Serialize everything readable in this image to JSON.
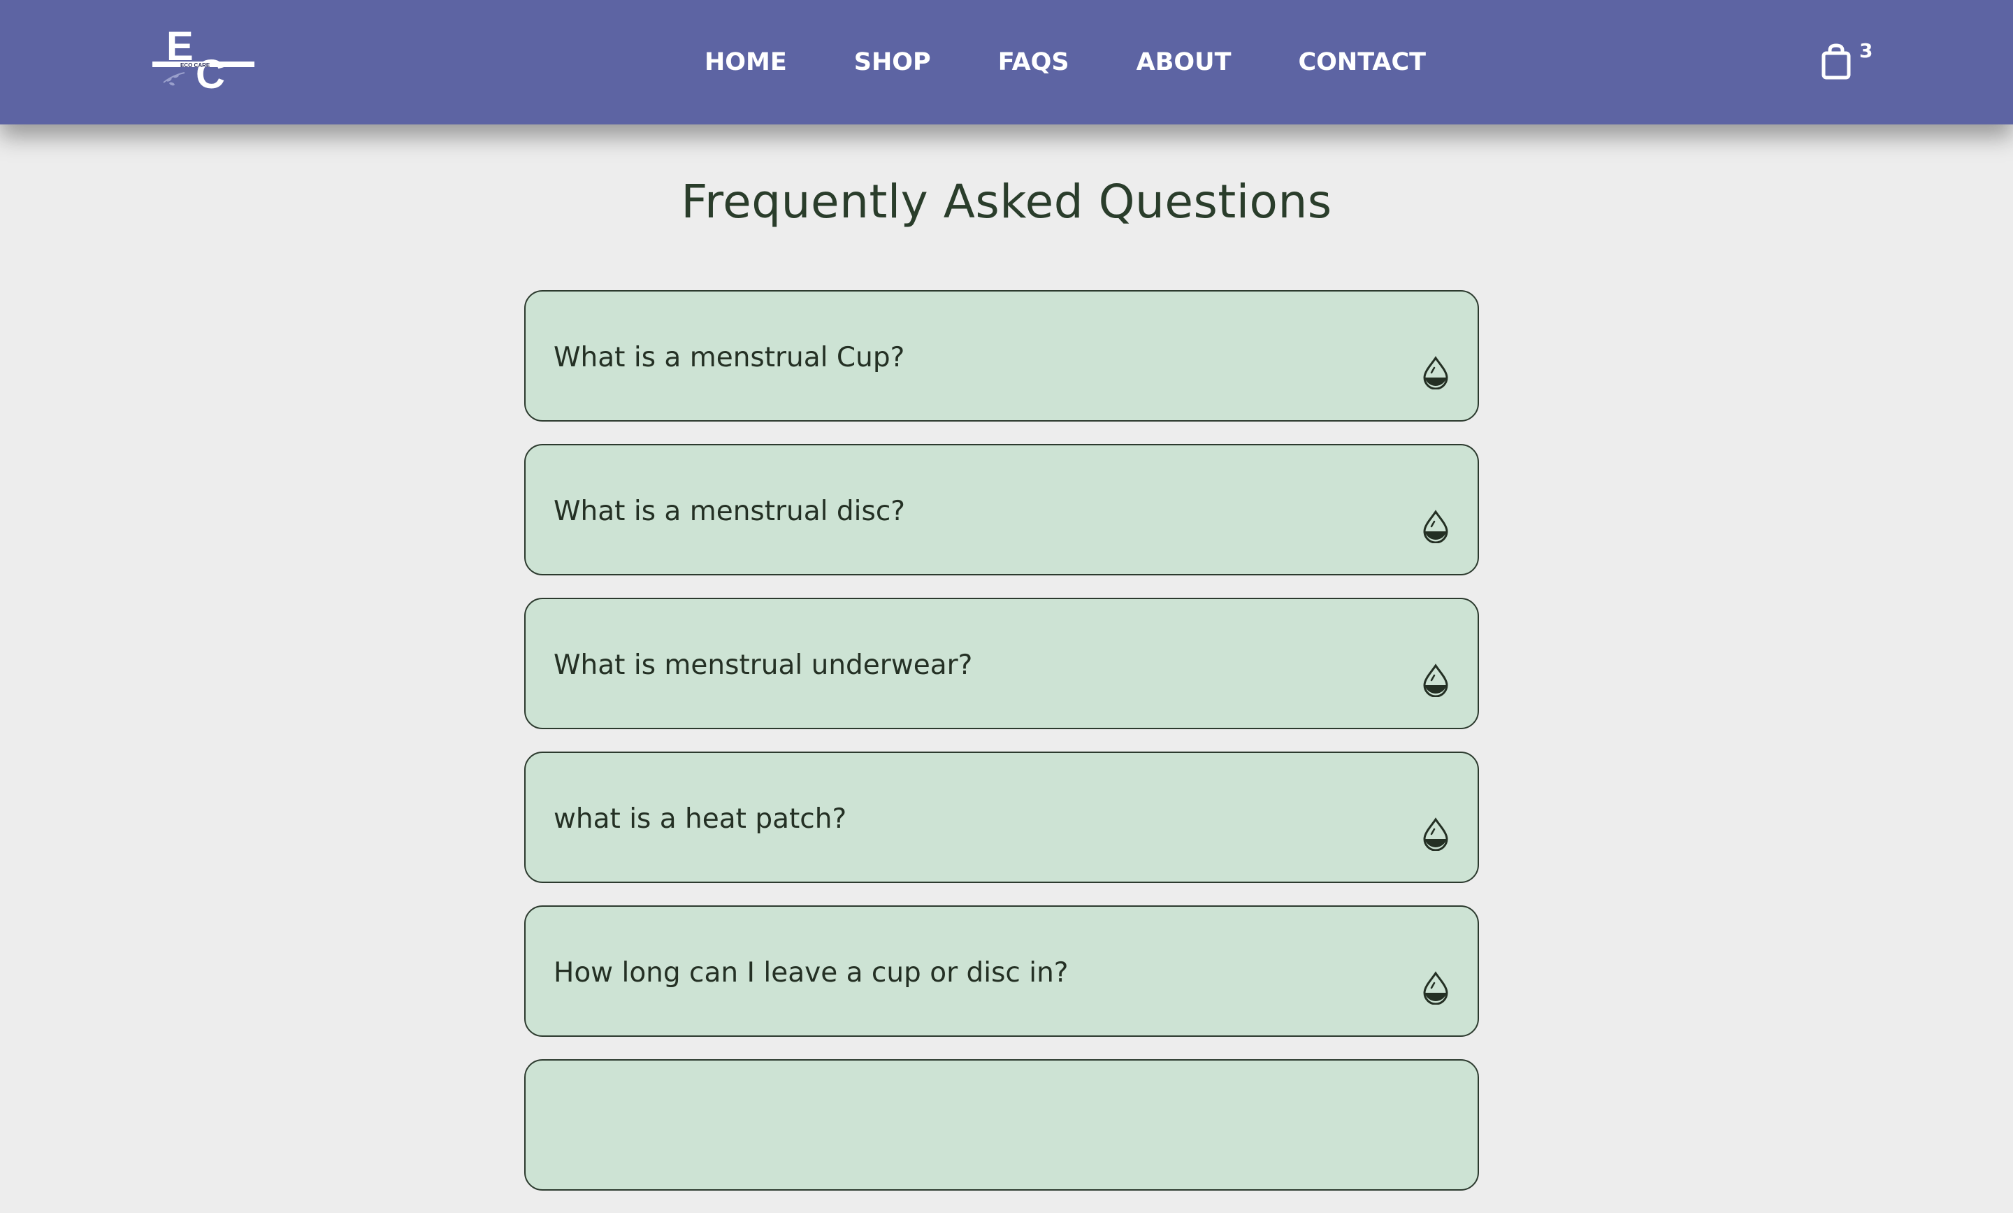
{
  "header": {
    "logo": {
      "letters": "EC",
      "tagline": "ECO CARE"
    },
    "nav": [
      {
        "label": "HOME"
      },
      {
        "label": "SHOP"
      },
      {
        "label": "FAQS"
      },
      {
        "label": "ABOUT"
      },
      {
        "label": "CONTACT"
      }
    ],
    "cart": {
      "icon": "shopping-bag-icon",
      "count": "3"
    }
  },
  "main": {
    "title": "Frequently Asked Questions",
    "faqs": [
      {
        "question": "What is a menstrual Cup?",
        "icon": "droplet-icon"
      },
      {
        "question": "What is a menstrual disc?",
        "icon": "droplet-icon"
      },
      {
        "question": "What is menstrual underwear?",
        "icon": "droplet-icon"
      },
      {
        "question": "what is a heat patch?",
        "icon": "droplet-icon"
      },
      {
        "question": "How long can I leave a cup or disc in?",
        "icon": "droplet-icon"
      },
      {
        "question": "",
        "icon": "droplet-icon"
      }
    ]
  },
  "colors": {
    "header_bg": "#5d64a3",
    "page_bg": "#ededed",
    "card_bg": "#cde3d4",
    "text_dark": "#2a3d2b"
  }
}
